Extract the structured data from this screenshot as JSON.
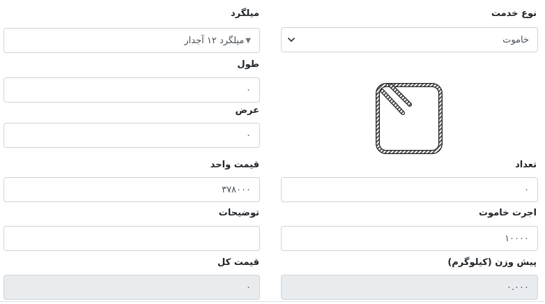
{
  "right": {
    "service_type": {
      "label": "نوع خدمت",
      "value": "خاموت"
    },
    "count": {
      "label": "تعداد",
      "value": "۰"
    },
    "stirrup_fee": {
      "label": "اجرت خاموت",
      "value": "۱۰۰۰۰"
    },
    "pre_weight": {
      "label": "پیش وزن (کیلوگرم)",
      "value": "۰.۰۰۰"
    }
  },
  "left": {
    "rebar": {
      "label": "میلگرد",
      "value": "میلگرد ۱۲ آجدار",
      "icon": "triangle-down"
    },
    "length": {
      "label": "طول",
      "value": "۰"
    },
    "width": {
      "label": "عرض",
      "value": "۰"
    },
    "unit_price": {
      "label": "قیمت واحد",
      "value": "۳۷۸۰۰۰"
    },
    "description": {
      "label": "توضیحات",
      "value": ""
    },
    "total_price": {
      "label": "قیمت کل",
      "value": "۰"
    }
  },
  "image": {
    "icon": "stirrup-rebar-icon"
  },
  "colors": {
    "border": "#ced4da",
    "readonly_bg": "#e9ecef",
    "text": "#212529"
  }
}
